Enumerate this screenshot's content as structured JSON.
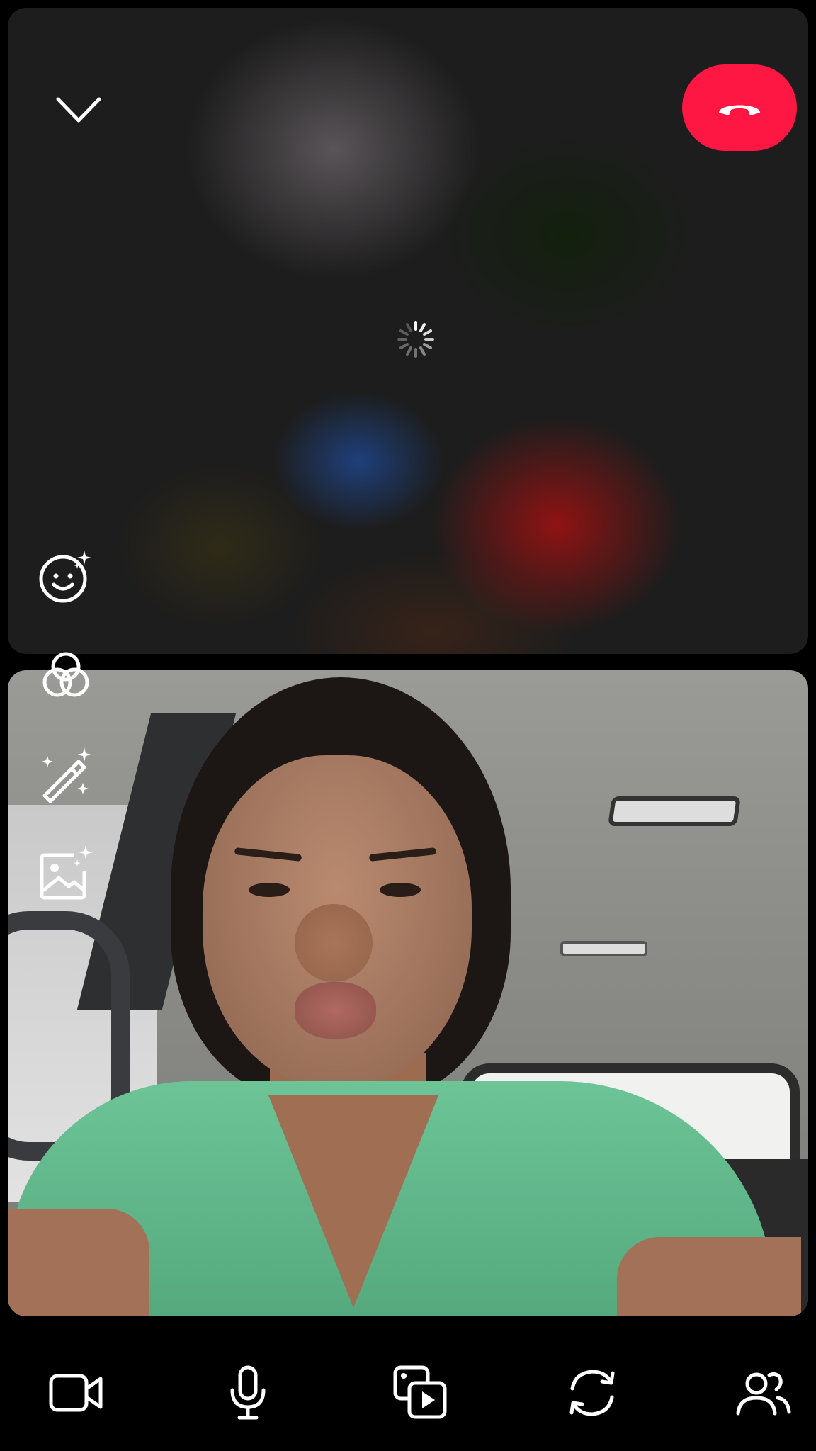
{
  "call": {
    "status": "connecting",
    "remote_video": "blurred-loading",
    "accent_colors": {
      "end_call": "#ff1744",
      "icon": "#ffffff",
      "background": "#000000"
    }
  },
  "top_controls": {
    "collapse_icon": "chevron-down-icon",
    "end_call_icon": "phone-hangup-icon"
  },
  "side_controls": [
    {
      "icon": "face-sparkle-icon"
    },
    {
      "icon": "filters-circles-icon"
    },
    {
      "icon": "magic-wand-icon"
    },
    {
      "icon": "image-sparkle-icon"
    }
  ],
  "toolbar": [
    {
      "icon": "video-camera-icon"
    },
    {
      "icon": "microphone-icon"
    },
    {
      "icon": "share-media-icon"
    },
    {
      "icon": "flip-camera-icon"
    },
    {
      "icon": "participants-icon"
    }
  ]
}
